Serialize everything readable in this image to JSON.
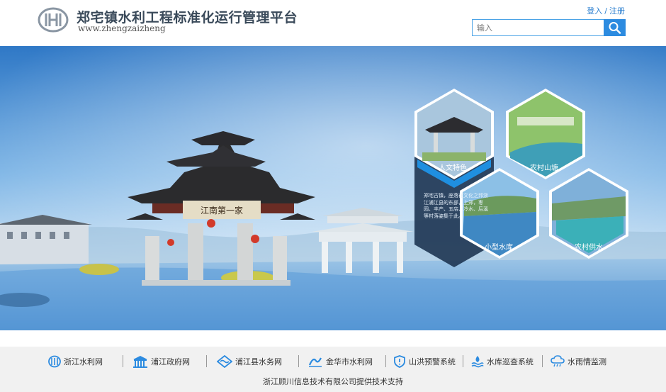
{
  "header": {
    "title": "郑宅镇水利工程标准化运行管理平台",
    "subtitle": "www.zhengzaizheng",
    "login_label": "登入",
    "separator": "/",
    "register_label": "注册",
    "search_placeholder": "输入"
  },
  "hero": {
    "tiles": [
      {
        "label": "人文特色",
        "icon": "heritage-photo"
      },
      {
        "label": "农村山塘",
        "icon": "pond-photo"
      },
      {
        "label": "小型水库",
        "icon": "reservoir-photo"
      },
      {
        "label": "农村供水",
        "icon": "water-supply-photo"
      }
    ],
    "description": "郑宅古镇，座落在文化之邦浙江浦江县的东部，上郑，枣园、丰产、五店、冷水、后溪等村落姿集于此。",
    "arch_plaque": "江南第一家"
  },
  "footer": {
    "links": [
      {
        "label": "浙江水利网",
        "icon": "zj-water-logo-icon"
      },
      {
        "label": "浦江政府网",
        "icon": "government-building-icon"
      },
      {
        "label": "浦江县水务网",
        "icon": "water-affairs-logo-icon"
      },
      {
        "label": "金华市水利网",
        "icon": "jinhua-water-logo-icon"
      },
      {
        "label": "山洪预警系统",
        "icon": "shield-warning-icon"
      },
      {
        "label": "水库巡查系统",
        "icon": "reservoir-patrol-icon"
      },
      {
        "label": "水雨情监测",
        "icon": "rain-cloud-icon"
      }
    ],
    "support_text": "浙江顾川信息技术有限公司提供技术支持"
  },
  "colors": {
    "accent": "#2c8be0",
    "sky_top": "#2f78c6",
    "footer_bg": "#f1f1f1",
    "hex_dark": "#1e3552",
    "hex_blue": "#1f8fe0"
  }
}
